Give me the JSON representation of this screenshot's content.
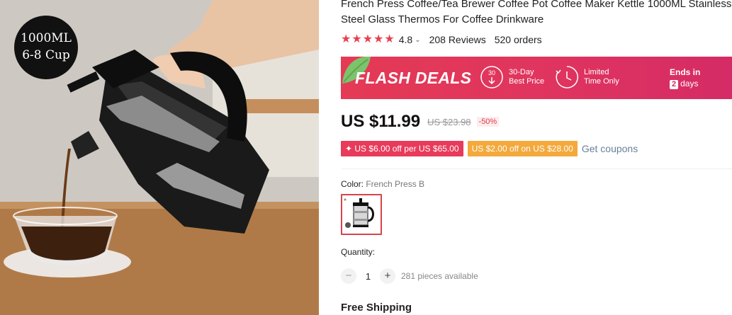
{
  "product": {
    "title": "French Press Coffee/Tea Brewer Coffee Pot Coffee Maker Kettle 1000ML Stainless Steel Glass Thermos For Coffee Drinkware",
    "image_badge_line1": "1000ML",
    "image_badge_line2": "6-8 Cup"
  },
  "rating": {
    "stars": 5,
    "value": "4.8",
    "reviews": "208 Reviews",
    "orders": "520 orders"
  },
  "flash_deals": {
    "title": "FLASH DEALS",
    "day_icon_number": "30",
    "best_price_line1": "30-Day",
    "best_price_line2": "Best Price",
    "limited_line1": "Limited",
    "limited_line2": "Time Only",
    "ends_in_label": "Ends in",
    "ends_in_number": "2",
    "ends_in_unit": "days"
  },
  "price": {
    "current": "US $11.99",
    "original": "US $23.98",
    "discount": "-50%"
  },
  "coupons": {
    "coupon1": "✦ US $6.00 off per US $65.00",
    "coupon2": "US $2.00 off on US $28.00",
    "get_coupons": "Get coupons"
  },
  "color": {
    "label": "Color: ",
    "value": "French Press B"
  },
  "quantity": {
    "label": "Quantity:",
    "minus": "−",
    "value": "1",
    "plus": "+",
    "available": "281 pieces available"
  },
  "shipping": {
    "label": "Free Shipping"
  },
  "colors": {
    "accent": "#e8404f",
    "banner": "#e0355e",
    "coupon_red": "#e83a5a",
    "coupon_orange": "#f3a93b",
    "link": "#68809a"
  }
}
